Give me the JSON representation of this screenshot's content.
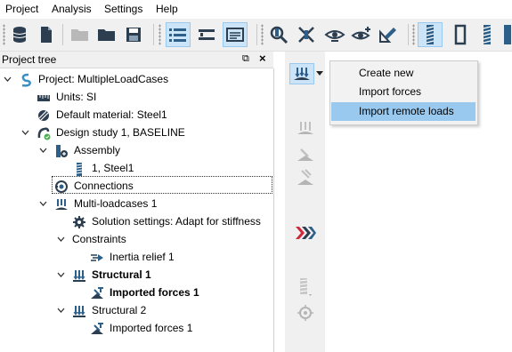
{
  "menu": {
    "items": [
      "Project",
      "Analysis",
      "Settings",
      "Help"
    ]
  },
  "colors": {
    "selection": "#cce4f7",
    "selection_border": "#99c9ef",
    "menu_highlight": "#99c9ef",
    "accent_red": "#d0283a",
    "icon_blue": "#2c5f8a"
  },
  "toolbar": {
    "icons": [
      "database-icon",
      "new-document-icon",
      "open-folder-disabled-icon",
      "folder-icon",
      "save-icon",
      "list-view-icon",
      "compare-icon",
      "report-icon",
      "zoom-model-icon",
      "hide-icon",
      "view-eye-icon",
      "add-view-icon",
      "measure-icon",
      "bolt-icon",
      "frame-icon",
      "spring-icon"
    ],
    "selected": [
      "list-view-icon",
      "report-icon",
      "bolt-icon"
    ]
  },
  "project_tree": {
    "title": "Project tree",
    "pin_glyph": "⧉",
    "close_glyph": "×",
    "items": [
      {
        "label": "Project: MultipleLoadCases",
        "icon": "project-icon",
        "expanded": true
      },
      {
        "label": "Units: SI",
        "icon": "units-icon"
      },
      {
        "label": "Default material: Steel1",
        "icon": "material-icon"
      },
      {
        "label": "Design study 1, BASELINE",
        "icon": "design-study-icon",
        "expanded": true
      },
      {
        "label": "Assembly",
        "icon": "assembly-icon",
        "expanded": true
      },
      {
        "label": "1, Steel1",
        "icon": "part-icon"
      },
      {
        "label": "Connections",
        "icon": "connections-icon",
        "focused": true
      },
      {
        "label": "Multi-loadcases  1",
        "icon": "multi-loadcase-icon",
        "expanded": true
      },
      {
        "label": "Solution settings: Adapt for stiffness",
        "icon": "settings-gear-icon"
      },
      {
        "label": "Constraints",
        "expanded": true
      },
      {
        "label": "Inertia relief 1",
        "icon": "inertia-relief-icon"
      },
      {
        "label": "Structural 1",
        "icon": "structural-icon",
        "expanded": true,
        "bold": true
      },
      {
        "label": "Imported forces 1",
        "icon": "imported-forces-icon",
        "bold": true
      },
      {
        "label": "Structural 2",
        "icon": "structural-icon",
        "expanded": true
      },
      {
        "label": "Imported forces 1",
        "icon": "imported-forces-icon"
      }
    ]
  },
  "side_toolbar": {
    "icons": [
      "load-dropdown-icon",
      "load-disabled-icon",
      "force-disabled-icon",
      "pressure-disabled-icon",
      "run-arrows-icon",
      "mesh-disabled-icon",
      "target-disabled-icon"
    ]
  },
  "dropdown": {
    "items": [
      {
        "label": "Create new"
      },
      {
        "label": "Import forces"
      },
      {
        "label": "Import remote loads",
        "highlighted": true
      }
    ]
  }
}
